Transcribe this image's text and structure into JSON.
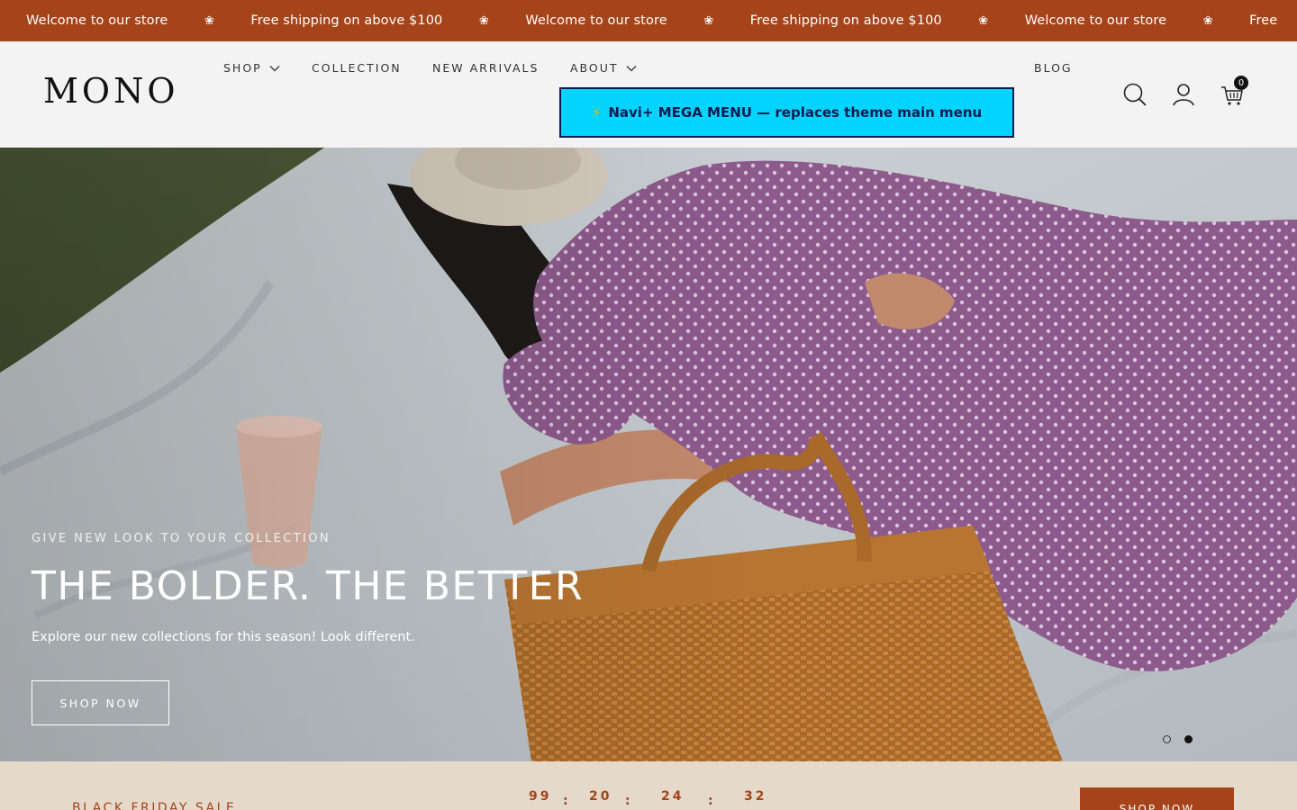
{
  "announcement": {
    "items": [
      "Welcome to our store",
      "Free shipping on above $100",
      "Welcome to our store",
      "Free shipping on above $100",
      "Welcome to our store",
      "Free"
    ],
    "separator": "❀",
    "bg_color": "#a5431a"
  },
  "header": {
    "logo": "MONO",
    "nav": [
      {
        "label": "SHOP",
        "has_dropdown": true
      },
      {
        "label": "COLLECTION",
        "has_dropdown": false
      },
      {
        "label": "NEW ARRIVALS",
        "has_dropdown": false
      },
      {
        "label": "ABOUT",
        "has_dropdown": true
      },
      {
        "label": "BLOG",
        "has_dropdown": false
      }
    ],
    "mega_menu_label": "Navi+ MEGA MENU — replaces theme main menu",
    "mega_menu_icon": "⚡",
    "cart_count": "0",
    "icons": [
      "search-icon",
      "account-icon",
      "cart-icon"
    ]
  },
  "hero": {
    "eyebrow": "GIVE NEW LOOK TO YOUR COLLECTION",
    "title": "THE BOLDER. THE BETTER",
    "description": "Explore our new collections for this season! Look different.",
    "button_label": "SHOP NOW",
    "slides_total": 2,
    "active_slide": 2
  },
  "sale": {
    "label": "BLACK FRIDAY SALE",
    "countdown": [
      "99",
      "20",
      "24",
      "32"
    ],
    "separator": ":",
    "button_label": "SHOP NOW",
    "accent_color": "#a5431a"
  }
}
